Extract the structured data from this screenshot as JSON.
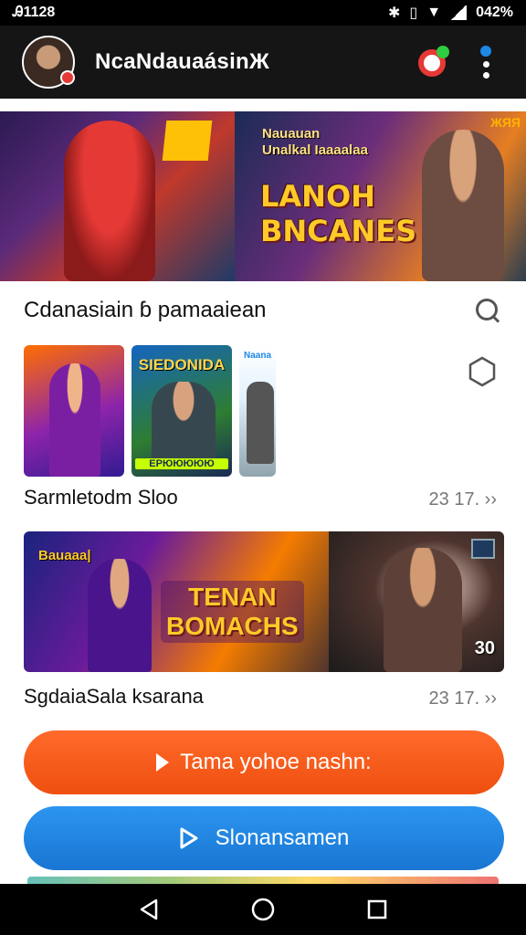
{
  "status_bar": {
    "time": "Ꭿ1128",
    "icons": [
      "bluetooth-icon",
      "vibrate-icon",
      "wifi-icon",
      "signal-icon"
    ],
    "battery": "042%"
  },
  "header": {
    "title": "NcaNdauaásinЖ",
    "avatar": "avatar",
    "actions": [
      "notification-icon",
      "more-options-icon"
    ]
  },
  "banner": {
    "left_tag": "",
    "right_subtitle": "Nauauan\nUnalkal Iaaaalaa",
    "right_title": "LANOH\nBNCANES",
    "corner_label": "ЖЯЯ"
  },
  "section1": {
    "title": "Cdanasiain ɓ pamaaiean",
    "action_icon": "search-icon"
  },
  "thumbnails": [
    {
      "top_label": "",
      "bottom_label": ""
    },
    {
      "top_label": "SIEDONIDA",
      "bottom_label": "ЕРЮЮЮЮЮ"
    },
    {
      "top_label": "Naana",
      "bottom_label": ""
    }
  ],
  "row1": {
    "label": "Sarmletodm Sloo",
    "meta": "23 17. ››"
  },
  "wide_card": {
    "tag": "Bauaaa|",
    "title": "TENAN\nBOMACHS",
    "badge": "30"
  },
  "row2": {
    "label": "SgdaiaSala ksarana",
    "meta": "23 17. ››"
  },
  "buttons": {
    "primary": "Tama yohoe nashn:",
    "secondary": "Slonansamen"
  },
  "colors": {
    "primary_button": "#ef5a1c",
    "secondary_button": "#1e88e5",
    "header_bg": "#151515"
  },
  "nav": [
    "back-icon",
    "home-icon",
    "recents-icon"
  ]
}
